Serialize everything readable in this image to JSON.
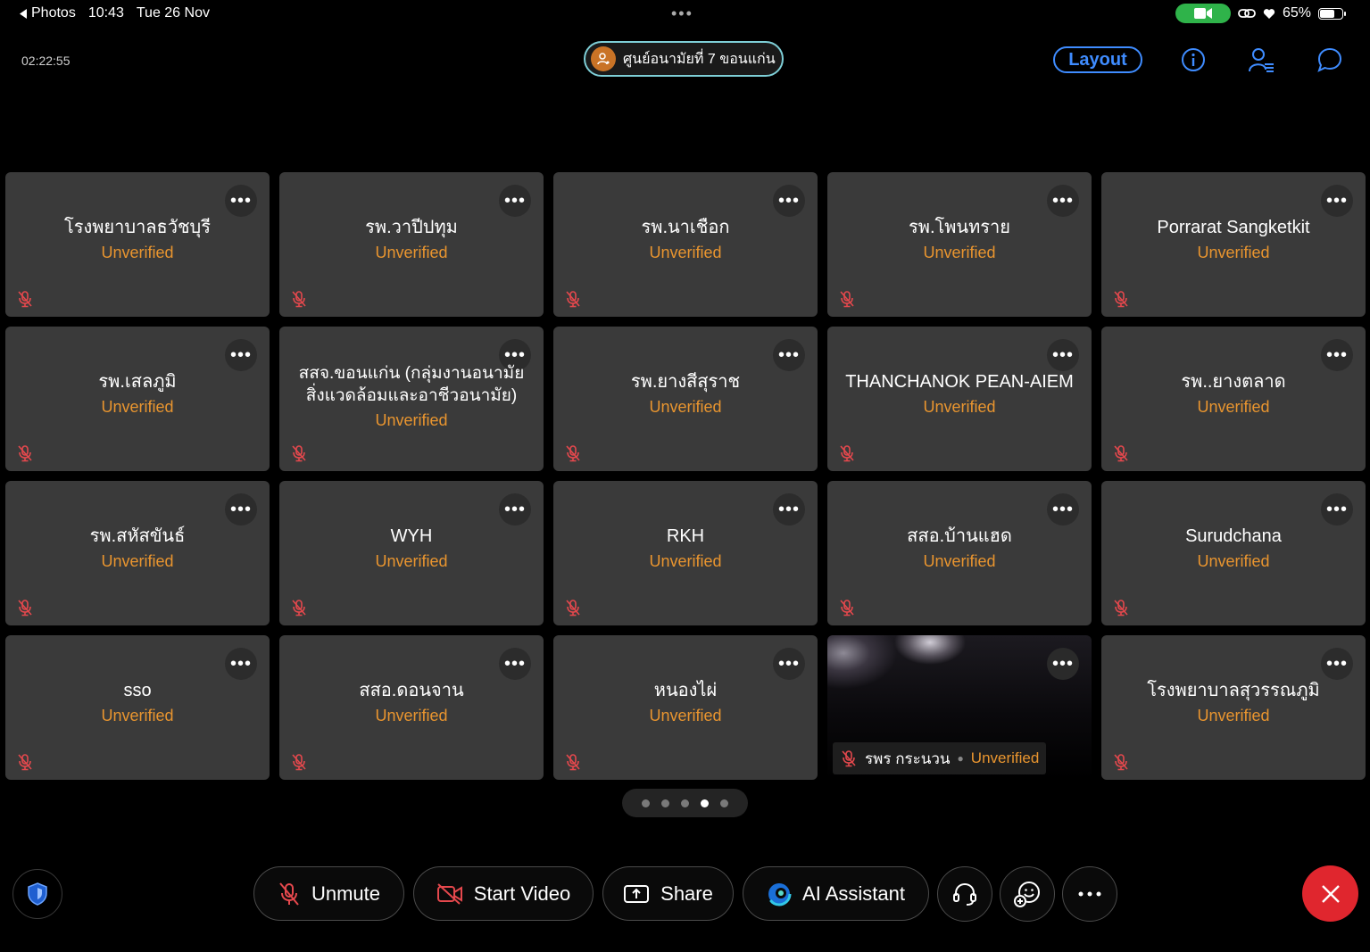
{
  "status_bar": {
    "back_label": "Photos",
    "time": "10:43",
    "date": "Tue 26 Nov",
    "battery": "65%",
    "battery_level": 0.65
  },
  "header": {
    "elapsed": "02:22:55",
    "host_name": "ศูนย์อนามัยที่ 7 ขอนแก่น",
    "layout_label": "Layout"
  },
  "participants": [
    {
      "name": "โรงพยาบาลธวัชบุรี",
      "status": "Unverified"
    },
    {
      "name": "รพ.วาปีปทุม",
      "status": "Unverified"
    },
    {
      "name": "รพ.นาเชือก",
      "status": "Unverified"
    },
    {
      "name": "รพ.โพนทราย",
      "status": "Unverified"
    },
    {
      "name": "Porrarat Sangketkit",
      "status": "Unverified"
    },
    {
      "name": "รพ.เสลภูมิ",
      "status": "Unverified"
    },
    {
      "name": "สสจ.ขอนแก่น (กลุ่มงานอนามัยสิ่งแวดล้อมและอาชีวอนามัย)",
      "status": "Unverified"
    },
    {
      "name": "รพ.ยางสีสุราช",
      "status": "Unverified"
    },
    {
      "name": "THANCHANOK PEAN-AIEM",
      "status": "Unverified"
    },
    {
      "name": "รพ..ยางตลาด",
      "status": "Unverified"
    },
    {
      "name": "รพ.สหัสขันธ์",
      "status": "Unverified"
    },
    {
      "name": "WYH",
      "status": "Unverified"
    },
    {
      "name": "RKH",
      "status": "Unverified"
    },
    {
      "name": "สสอ.บ้านแฮด",
      "status": "Unverified"
    },
    {
      "name": "Surudchana",
      "status": "Unverified"
    },
    {
      "name": "sso",
      "status": "Unverified"
    },
    {
      "name": "สสอ.ดอนจาน",
      "status": "Unverified"
    },
    {
      "name": "หนองไผ่",
      "status": "Unverified"
    },
    {
      "name": "รพร กระนวน",
      "status": "Unverified"
    },
    {
      "name": "โรงพยาบาลสุวรรณภูมิ",
      "status": "Unverified"
    }
  ],
  "pager": {
    "total": 5,
    "active_index": 3
  },
  "toolbar": {
    "unmute_label": "Unmute",
    "start_video_label": "Start Video",
    "share_label": "Share",
    "ai_assistant_label": "AI Assistant"
  },
  "colors": {
    "accent": "#3f8cff",
    "unverified": "#e9952f",
    "muted_mic": "#e5484d",
    "leave": "#e0262e",
    "tile_bg": "#3a3a3a"
  }
}
